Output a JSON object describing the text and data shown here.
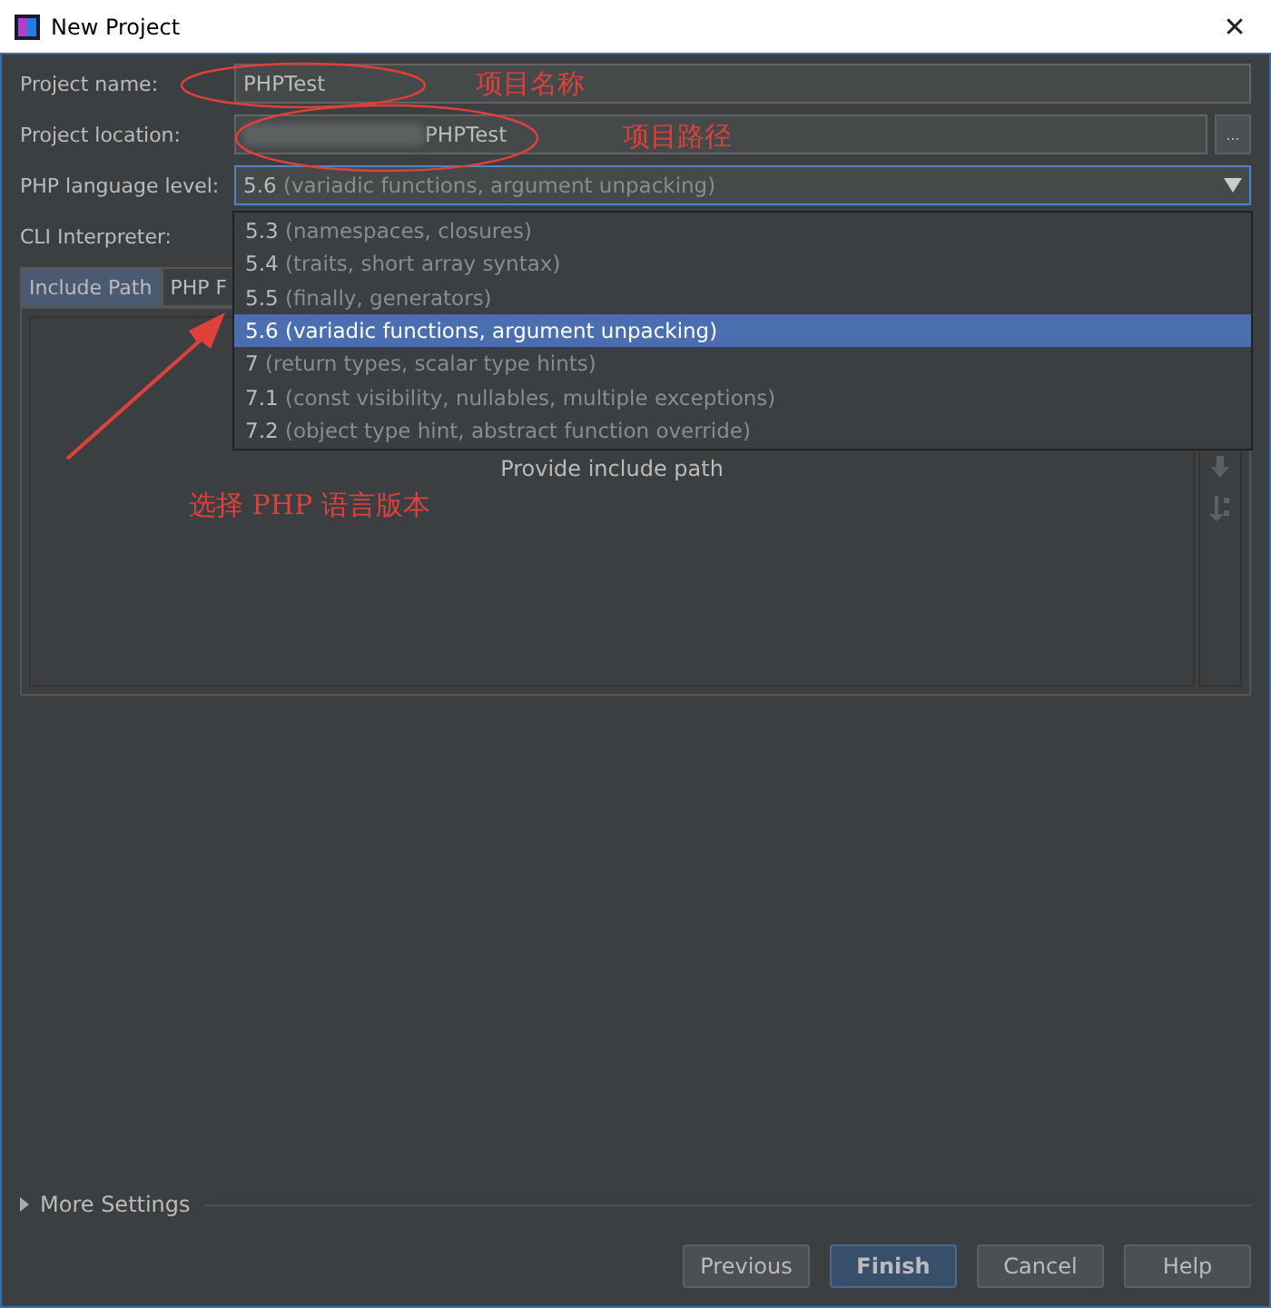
{
  "window": {
    "title": "New Project",
    "close": "✕"
  },
  "form": {
    "name_label": "Project name:",
    "name_value": "PHPTest",
    "location_label": "Project location:",
    "location_value": "PHPTest",
    "browse": "...",
    "level_label": "PHP language level:",
    "level_version": "5.6",
    "level_desc": "(variadic functions, argument unpacking)",
    "cli_label": "CLI Interpreter:"
  },
  "dropdown": [
    {
      "version": "5.3",
      "desc": "(namespaces, closures)",
      "selected": false
    },
    {
      "version": "5.4",
      "desc": "(traits, short array syntax)",
      "selected": false
    },
    {
      "version": "5.5",
      "desc": "(finally, generators)",
      "selected": false
    },
    {
      "version": "5.6",
      "desc": "(variadic functions, argument unpacking)",
      "selected": true
    },
    {
      "version": "7",
      "desc": "(return types, scalar type hints)",
      "selected": false
    },
    {
      "version": "7.1",
      "desc": "(const visibility, nullables, multiple exceptions)",
      "selected": false
    },
    {
      "version": "7.2",
      "desc": "(object type hint, abstract function override)",
      "selected": false
    }
  ],
  "tabs": [
    {
      "label": "Include Path",
      "selected": true
    },
    {
      "label": "PHP F",
      "selected": false
    }
  ],
  "panel": {
    "empty_text": "Provide include path"
  },
  "more_settings": {
    "label": "More Settings",
    "expanded": false
  },
  "buttons": [
    {
      "label": "Previous",
      "kind": "normal"
    },
    {
      "label": "Finish",
      "kind": "default"
    },
    {
      "label": "Cancel",
      "kind": "normal"
    },
    {
      "label": "Help",
      "kind": "normal"
    }
  ],
  "annotations": [
    {
      "text": "项目名称"
    },
    {
      "text": "项目路径"
    },
    {
      "text": "选择 PHP 语言版本"
    }
  ]
}
